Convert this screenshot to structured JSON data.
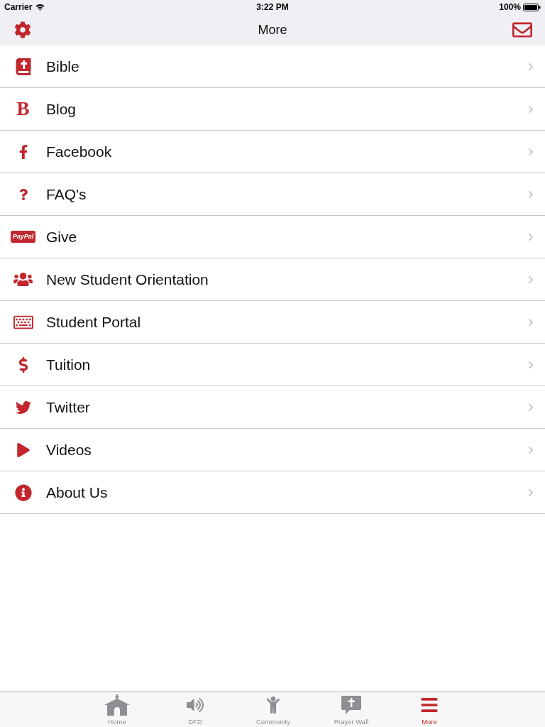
{
  "status_bar": {
    "carrier": "Carrier",
    "time": "3:22 PM",
    "battery": "100%"
  },
  "nav_bar": {
    "title": "More"
  },
  "menu": [
    {
      "kind": "icon",
      "label": "Bible"
    },
    {
      "kind": "letter",
      "glyph": "B",
      "label": "Blog"
    },
    {
      "kind": "icon",
      "label": "Facebook"
    },
    {
      "kind": "icon",
      "label": "FAQ's"
    },
    {
      "kind": "badge",
      "glyph": "PayPal",
      "label": "Give"
    },
    {
      "kind": "icon",
      "label": "New Student Orientation"
    },
    {
      "kind": "icon",
      "label": "Student Portal"
    },
    {
      "kind": "icon",
      "label": "Tuition"
    },
    {
      "kind": "icon",
      "label": "Twitter"
    },
    {
      "kind": "icon",
      "label": "Videos"
    },
    {
      "kind": "icon",
      "label": "About Us"
    }
  ],
  "tab_bar": [
    {
      "label": "Home",
      "selected": false
    },
    {
      "label": "DFD",
      "selected": false
    },
    {
      "label": "Community",
      "selected": false
    },
    {
      "label": "Prayer Wall",
      "selected": false
    },
    {
      "label": "More",
      "selected": true
    }
  ]
}
